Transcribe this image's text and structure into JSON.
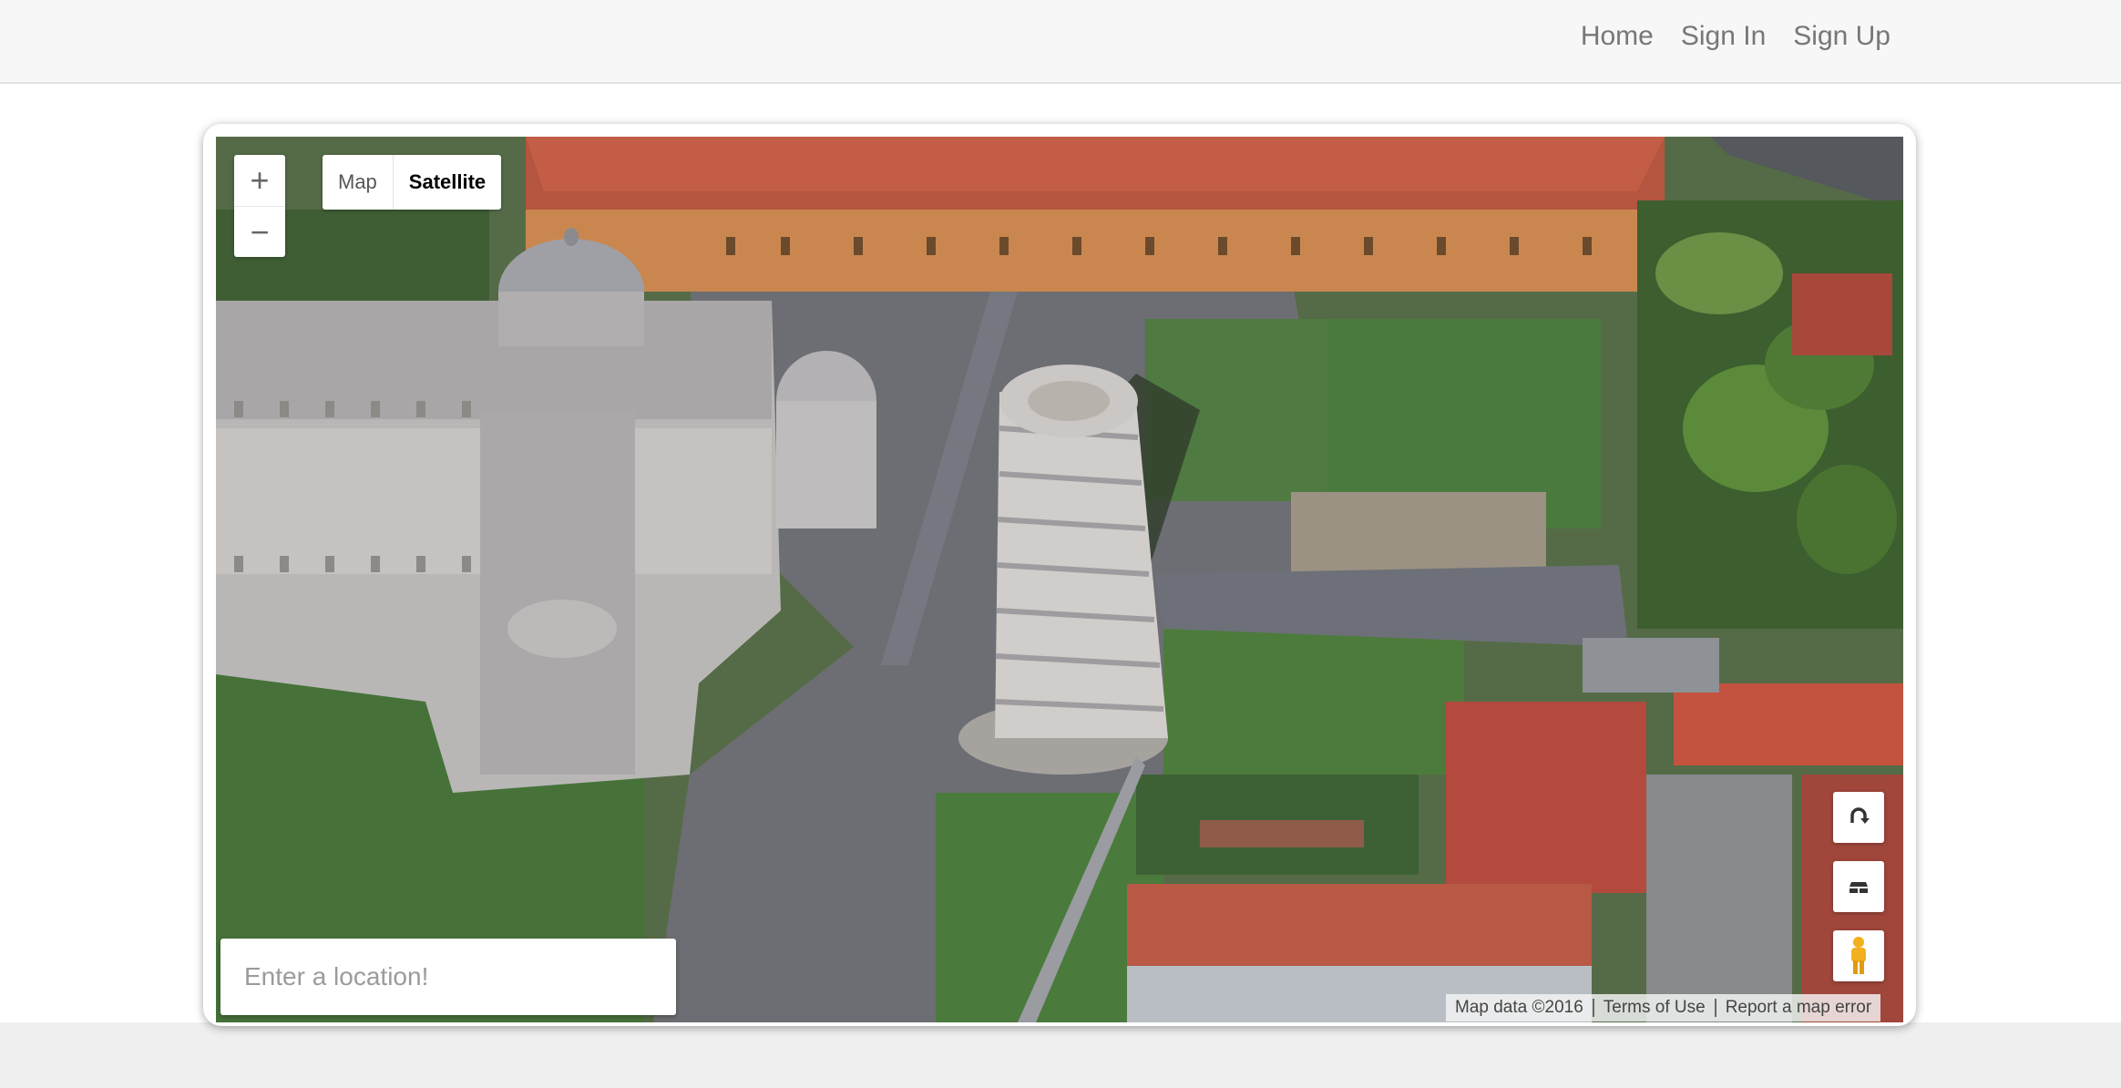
{
  "nav": {
    "links": [
      "Home",
      "Sign In",
      "Sign Up"
    ]
  },
  "map": {
    "map_type": {
      "options": [
        "Map",
        "Satellite"
      ],
      "selected": "Satellite"
    },
    "zoom": {
      "in_symbol": "+",
      "out_symbol": "−"
    },
    "controls": [
      "rotate-icon",
      "tilt-icon",
      "pegman-icon"
    ],
    "search": {
      "placeholder": "Enter a location!",
      "value": ""
    },
    "attribution": {
      "data": "Map data ©2016",
      "terms": "Terms of Use",
      "report": "Report a map error"
    }
  },
  "colors": {
    "navbar_bg": "#f7f7f7",
    "page_bg": "#efefef",
    "nav_text": "#777777"
  }
}
